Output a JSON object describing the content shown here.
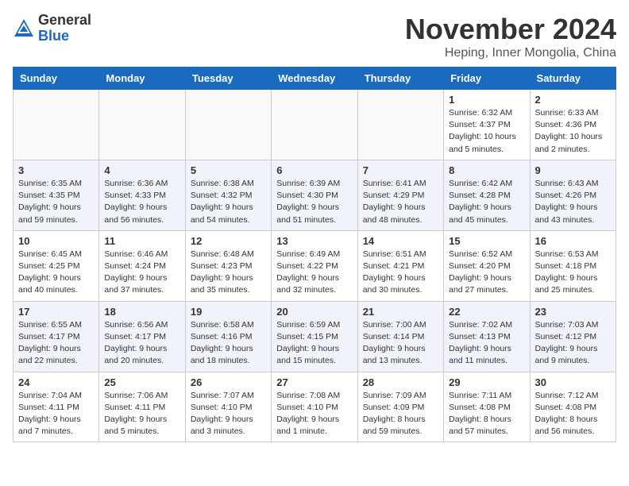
{
  "logo": {
    "general": "General",
    "blue": "Blue"
  },
  "header": {
    "month": "November 2024",
    "location": "Heping, Inner Mongolia, China"
  },
  "weekdays": [
    "Sunday",
    "Monday",
    "Tuesday",
    "Wednesday",
    "Thursday",
    "Friday",
    "Saturday"
  ],
  "weeks": [
    [
      {
        "day": "",
        "empty": true
      },
      {
        "day": "",
        "empty": true
      },
      {
        "day": "",
        "empty": true
      },
      {
        "day": "",
        "empty": true
      },
      {
        "day": "",
        "empty": true
      },
      {
        "day": "1",
        "sunrise": "Sunrise: 6:32 AM",
        "sunset": "Sunset: 4:37 PM",
        "daylight": "Daylight: 10 hours and 5 minutes."
      },
      {
        "day": "2",
        "sunrise": "Sunrise: 6:33 AM",
        "sunset": "Sunset: 4:36 PM",
        "daylight": "Daylight: 10 hours and 2 minutes."
      }
    ],
    [
      {
        "day": "3",
        "sunrise": "Sunrise: 6:35 AM",
        "sunset": "Sunset: 4:35 PM",
        "daylight": "Daylight: 9 hours and 59 minutes."
      },
      {
        "day": "4",
        "sunrise": "Sunrise: 6:36 AM",
        "sunset": "Sunset: 4:33 PM",
        "daylight": "Daylight: 9 hours and 56 minutes."
      },
      {
        "day": "5",
        "sunrise": "Sunrise: 6:38 AM",
        "sunset": "Sunset: 4:32 PM",
        "daylight": "Daylight: 9 hours and 54 minutes."
      },
      {
        "day": "6",
        "sunrise": "Sunrise: 6:39 AM",
        "sunset": "Sunset: 4:30 PM",
        "daylight": "Daylight: 9 hours and 51 minutes."
      },
      {
        "day": "7",
        "sunrise": "Sunrise: 6:41 AM",
        "sunset": "Sunset: 4:29 PM",
        "daylight": "Daylight: 9 hours and 48 minutes."
      },
      {
        "day": "8",
        "sunrise": "Sunrise: 6:42 AM",
        "sunset": "Sunset: 4:28 PM",
        "daylight": "Daylight: 9 hours and 45 minutes."
      },
      {
        "day": "9",
        "sunrise": "Sunrise: 6:43 AM",
        "sunset": "Sunset: 4:26 PM",
        "daylight": "Daylight: 9 hours and 43 minutes."
      }
    ],
    [
      {
        "day": "10",
        "sunrise": "Sunrise: 6:45 AM",
        "sunset": "Sunset: 4:25 PM",
        "daylight": "Daylight: 9 hours and 40 minutes."
      },
      {
        "day": "11",
        "sunrise": "Sunrise: 6:46 AM",
        "sunset": "Sunset: 4:24 PM",
        "daylight": "Daylight: 9 hours and 37 minutes."
      },
      {
        "day": "12",
        "sunrise": "Sunrise: 6:48 AM",
        "sunset": "Sunset: 4:23 PM",
        "daylight": "Daylight: 9 hours and 35 minutes."
      },
      {
        "day": "13",
        "sunrise": "Sunrise: 6:49 AM",
        "sunset": "Sunset: 4:22 PM",
        "daylight": "Daylight: 9 hours and 32 minutes."
      },
      {
        "day": "14",
        "sunrise": "Sunrise: 6:51 AM",
        "sunset": "Sunset: 4:21 PM",
        "daylight": "Daylight: 9 hours and 30 minutes."
      },
      {
        "day": "15",
        "sunrise": "Sunrise: 6:52 AM",
        "sunset": "Sunset: 4:20 PM",
        "daylight": "Daylight: 9 hours and 27 minutes."
      },
      {
        "day": "16",
        "sunrise": "Sunrise: 6:53 AM",
        "sunset": "Sunset: 4:18 PM",
        "daylight": "Daylight: 9 hours and 25 minutes."
      }
    ],
    [
      {
        "day": "17",
        "sunrise": "Sunrise: 6:55 AM",
        "sunset": "Sunset: 4:17 PM",
        "daylight": "Daylight: 9 hours and 22 minutes."
      },
      {
        "day": "18",
        "sunrise": "Sunrise: 6:56 AM",
        "sunset": "Sunset: 4:17 PM",
        "daylight": "Daylight: 9 hours and 20 minutes."
      },
      {
        "day": "19",
        "sunrise": "Sunrise: 6:58 AM",
        "sunset": "Sunset: 4:16 PM",
        "daylight": "Daylight: 9 hours and 18 minutes."
      },
      {
        "day": "20",
        "sunrise": "Sunrise: 6:59 AM",
        "sunset": "Sunset: 4:15 PM",
        "daylight": "Daylight: 9 hours and 15 minutes."
      },
      {
        "day": "21",
        "sunrise": "Sunrise: 7:00 AM",
        "sunset": "Sunset: 4:14 PM",
        "daylight": "Daylight: 9 hours and 13 minutes."
      },
      {
        "day": "22",
        "sunrise": "Sunrise: 7:02 AM",
        "sunset": "Sunset: 4:13 PM",
        "daylight": "Daylight: 9 hours and 11 minutes."
      },
      {
        "day": "23",
        "sunrise": "Sunrise: 7:03 AM",
        "sunset": "Sunset: 4:12 PM",
        "daylight": "Daylight: 9 hours and 9 minutes."
      }
    ],
    [
      {
        "day": "24",
        "sunrise": "Sunrise: 7:04 AM",
        "sunset": "Sunset: 4:11 PM",
        "daylight": "Daylight: 9 hours and 7 minutes."
      },
      {
        "day": "25",
        "sunrise": "Sunrise: 7:06 AM",
        "sunset": "Sunset: 4:11 PM",
        "daylight": "Daylight: 9 hours and 5 minutes."
      },
      {
        "day": "26",
        "sunrise": "Sunrise: 7:07 AM",
        "sunset": "Sunset: 4:10 PM",
        "daylight": "Daylight: 9 hours and 3 minutes."
      },
      {
        "day": "27",
        "sunrise": "Sunrise: 7:08 AM",
        "sunset": "Sunset: 4:10 PM",
        "daylight": "Daylight: 9 hours and 1 minute."
      },
      {
        "day": "28",
        "sunrise": "Sunrise: 7:09 AM",
        "sunset": "Sunset: 4:09 PM",
        "daylight": "Daylight: 8 hours and 59 minutes."
      },
      {
        "day": "29",
        "sunrise": "Sunrise: 7:11 AM",
        "sunset": "Sunset: 4:08 PM",
        "daylight": "Daylight: 8 hours and 57 minutes."
      },
      {
        "day": "30",
        "sunrise": "Sunrise: 7:12 AM",
        "sunset": "Sunset: 4:08 PM",
        "daylight": "Daylight: 8 hours and 56 minutes."
      }
    ]
  ]
}
